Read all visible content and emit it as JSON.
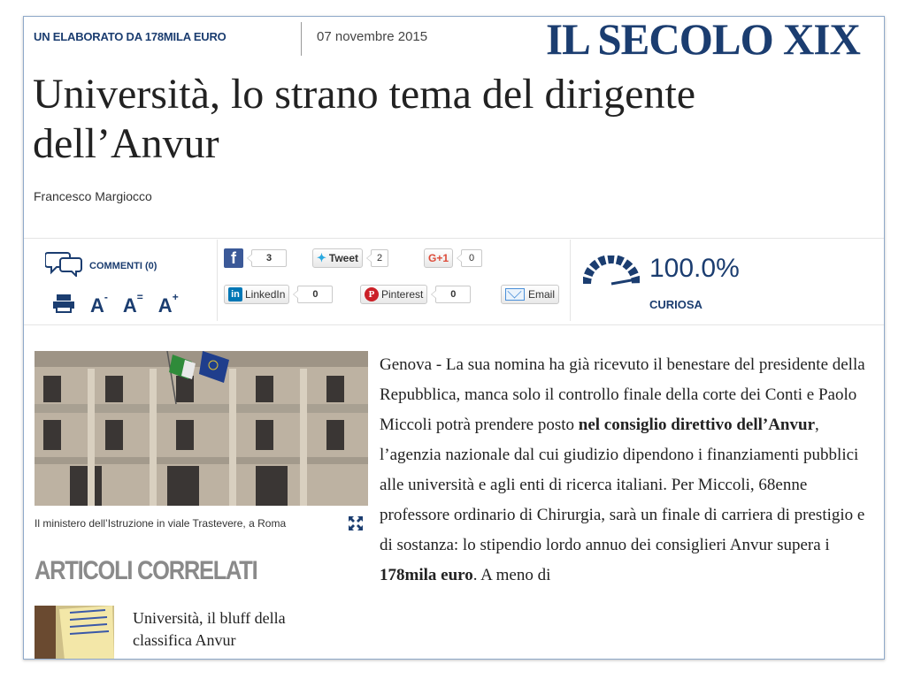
{
  "header": {
    "kicker": "UN ELABORATO DA 178MILA EURO",
    "date": "07 novembre 2015",
    "logo": "IL SECOLO XIX"
  },
  "article": {
    "title": "Università, lo strano tema del dirigente dell’Anvur",
    "author": "Francesco Margiocco",
    "body": {
      "p1": "Genova - La sua nomina ha già ricevuto il benestare del presidente della Repubblica, manca solo il controllo finale della corte dei Conti e Paolo Miccoli potrà prendere posto ",
      "bold1": "nel consiglio direttivo dell’Anvur",
      "p2": ", l’agenzia nazionale dal cui giudizio dipendono i finanziamenti pubblici alle università e agli enti di ricerca italiani. Per Miccoli, 68enne professore ordinario di Chirurgia, sarà un finale di carriera di prestigio e di sostanza: lo stipendio lordo annuo dei consiglieri Anvur supera i ",
      "bold2": "178mila euro",
      "p3": ". A meno di"
    }
  },
  "toolbar": {
    "comments_label": "COMMENTI (0)",
    "font_decrease": "A",
    "font_reset": "A",
    "font_increase": "A",
    "font_decrease_mark": "-",
    "font_reset_mark": "=",
    "font_increase_mark": "+"
  },
  "share": {
    "facebook_count": "3",
    "tweet_label": "Tweet",
    "tweet_count": "2",
    "gplus_label": "G+1",
    "gplus_count": "0",
    "linkedin_label": "LinkedIn",
    "linkedin_count": "0",
    "pinterest_label": "Pinterest",
    "pinterest_count": "0",
    "email_label": "Email"
  },
  "mood": {
    "value": "100.0%",
    "label": "CURIOSA",
    "level": 1.0
  },
  "media": {
    "caption": "Il ministero dell’Istruzione in viale Trastevere, a Roma"
  },
  "related": {
    "title": "ARTICOLI CORRELATI",
    "items": [
      {
        "title": "Università, il bluff della classifica Anvur"
      }
    ]
  },
  "colors": {
    "brand": "#1b3d70",
    "facebook": "#3b5998",
    "twitter": "#2aa9e0",
    "gplus": "#dd4b39",
    "linkedin": "#0077b5",
    "pinterest": "#cb2027"
  }
}
